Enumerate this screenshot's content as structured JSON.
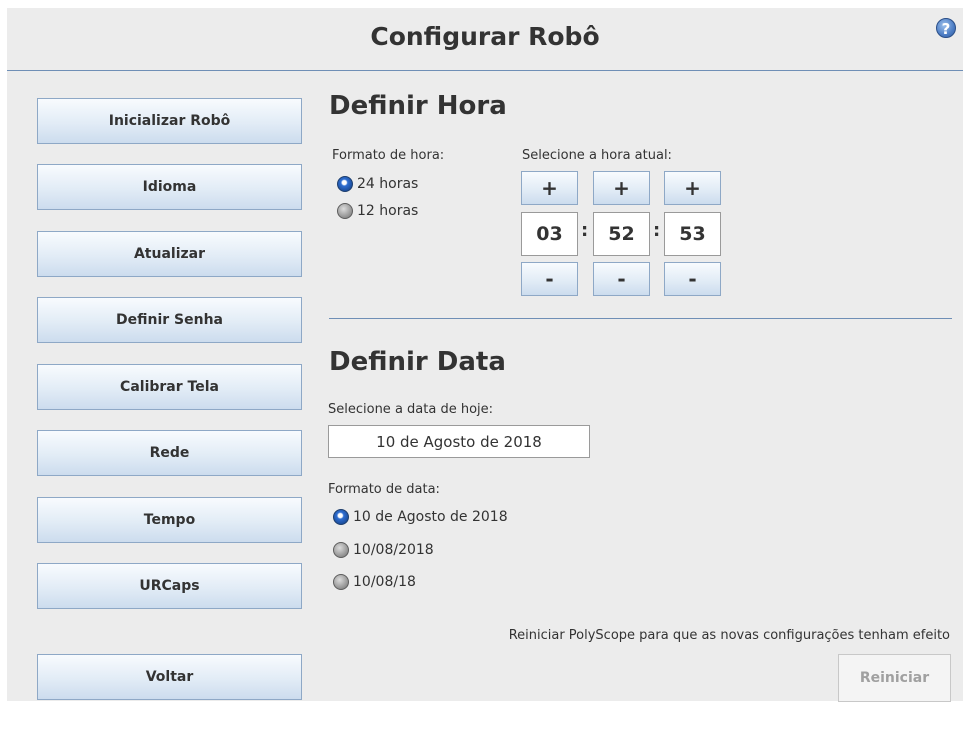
{
  "header": {
    "title": "Configurar Robô",
    "help_label": "?"
  },
  "sidebar": {
    "items": [
      {
        "label": "Inicializar Robô"
      },
      {
        "label": "Idioma"
      },
      {
        "label": "Atualizar"
      },
      {
        "label": "Definir Senha"
      },
      {
        "label": "Calibrar Tela"
      },
      {
        "label": "Rede"
      },
      {
        "label": "Tempo"
      },
      {
        "label": "URCaps"
      }
    ],
    "back_label": "Voltar"
  },
  "time": {
    "title": "Definir Hora",
    "format_label": "Formato de hora:",
    "select_label": "Selecione a hora atual:",
    "formats": [
      {
        "label": "24 horas",
        "selected": true
      },
      {
        "label": "12 horas",
        "selected": false
      }
    ],
    "plus_label": "+",
    "minus_label": "-",
    "hour": "03",
    "minute": "52",
    "second": "53",
    "separator": ":"
  },
  "date": {
    "title": "Definir Data",
    "select_label": "Selecione a data de hoje:",
    "value": "10 de Agosto de 2018",
    "format_label": "Formato de data:",
    "formats": [
      {
        "label": "10 de Agosto de 2018",
        "selected": true
      },
      {
        "label": "10/08/2018",
        "selected": false
      },
      {
        "label": "10/08/18",
        "selected": false
      }
    ]
  },
  "footer": {
    "note": "Reiniciar PolyScope para que as novas configurações tenham efeito",
    "restart_label": "Reiniciar"
  }
}
